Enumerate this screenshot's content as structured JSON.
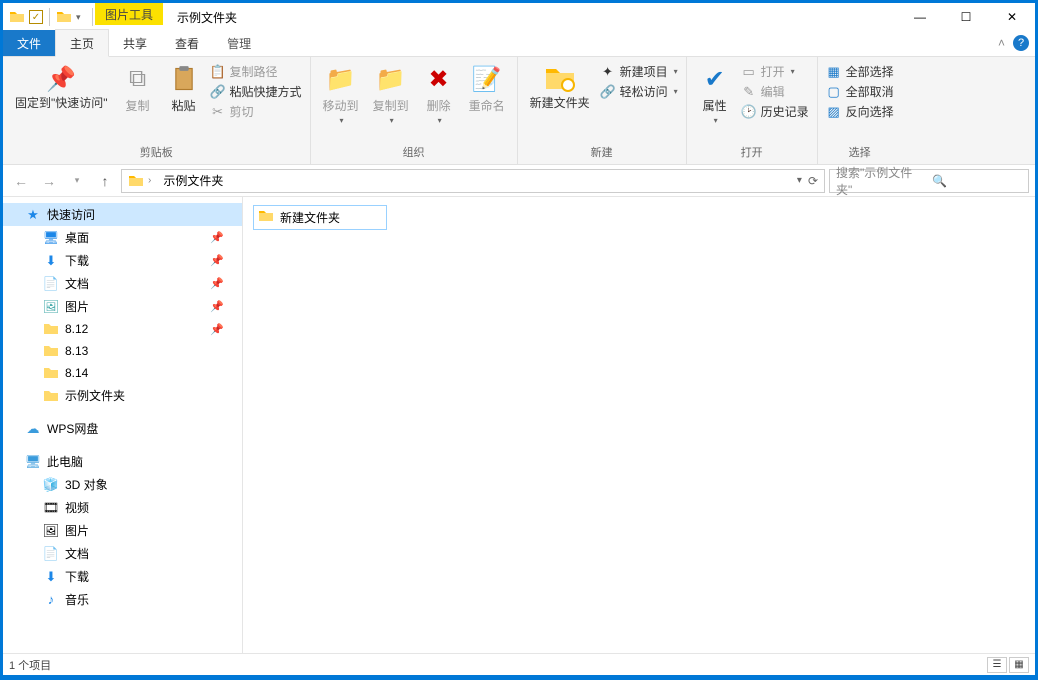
{
  "titlebar": {
    "tools_tab": "图片工具",
    "title": "示例文件夹"
  },
  "tabs": {
    "file": "文件",
    "home": "主页",
    "share": "共享",
    "view": "查看",
    "manage": "管理"
  },
  "ribbon": {
    "clipboard": {
      "pin": "固定到\"快速访问\"",
      "copy": "复制",
      "paste": "粘贴",
      "copy_path": "复制路径",
      "paste_shortcut": "粘贴快捷方式",
      "cut": "剪切",
      "group": "剪贴板"
    },
    "organize": {
      "move_to": "移动到",
      "copy_to": "复制到",
      "delete": "删除",
      "rename": "重命名",
      "group": "组织"
    },
    "new": {
      "new_folder": "新建文件夹",
      "new_item": "新建项目",
      "easy_access": "轻松访问",
      "group": "新建"
    },
    "open": {
      "properties": "属性",
      "open": "打开",
      "edit": "编辑",
      "history": "历史记录",
      "group": "打开"
    },
    "select": {
      "select_all": "全部选择",
      "select_none": "全部取消",
      "invert": "反向选择",
      "group": "选择"
    }
  },
  "address": {
    "crumb": "示例文件夹",
    "search_placeholder": "搜索\"示例文件夹\""
  },
  "nav": {
    "quick_access": "快速访问",
    "desktop": "桌面",
    "downloads": "下载",
    "documents": "文档",
    "pictures": "图片",
    "f_812": "8.12",
    "f_813": "8.13",
    "f_814": "8.14",
    "sample": "示例文件夹",
    "wps": "WPS网盘",
    "this_pc": "此电脑",
    "objects_3d": "3D 对象",
    "videos": "视频",
    "pictures2": "图片",
    "documents2": "文档",
    "downloads2": "下载",
    "music": "音乐"
  },
  "content": {
    "item0": "新建文件夹"
  },
  "status": {
    "count": "1 个项目"
  }
}
